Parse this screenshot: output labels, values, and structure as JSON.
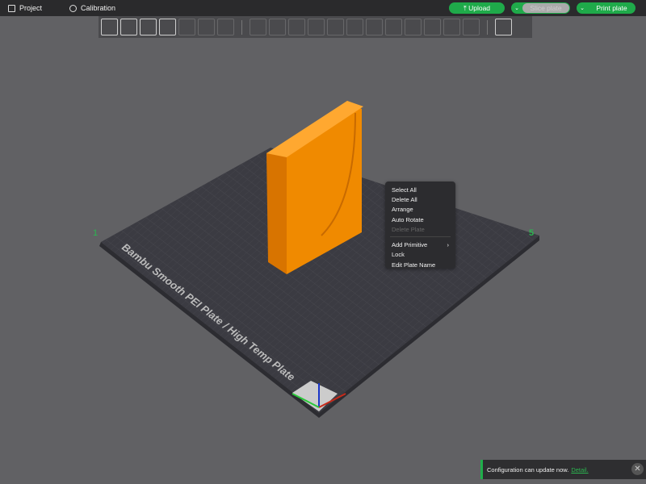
{
  "topbar": {
    "project": "Project",
    "calibration": "Calibration",
    "upload": "Upload",
    "slice": "Slice plate",
    "print": "Print plate"
  },
  "plate": {
    "label": "Bambu Smooth PEI Plate / High Temp Plate",
    "plate_number_left": "1",
    "plate_number_right": "5"
  },
  "context_menu": {
    "items": [
      {
        "label": "Select All"
      },
      {
        "label": "Delete All"
      },
      {
        "label": "Arrange"
      },
      {
        "label": "Auto Rotate"
      },
      {
        "label": "Delete Plate",
        "disabled": true
      }
    ],
    "items2": [
      {
        "label": "Add Primitive"
      },
      {
        "label": "Lock"
      },
      {
        "label": "Edit Plate Name"
      }
    ]
  },
  "notification": {
    "text": "Configuration can update now.",
    "link": "Detail."
  },
  "colors": {
    "accent": "#1faa4a",
    "object": "#f08a00"
  }
}
